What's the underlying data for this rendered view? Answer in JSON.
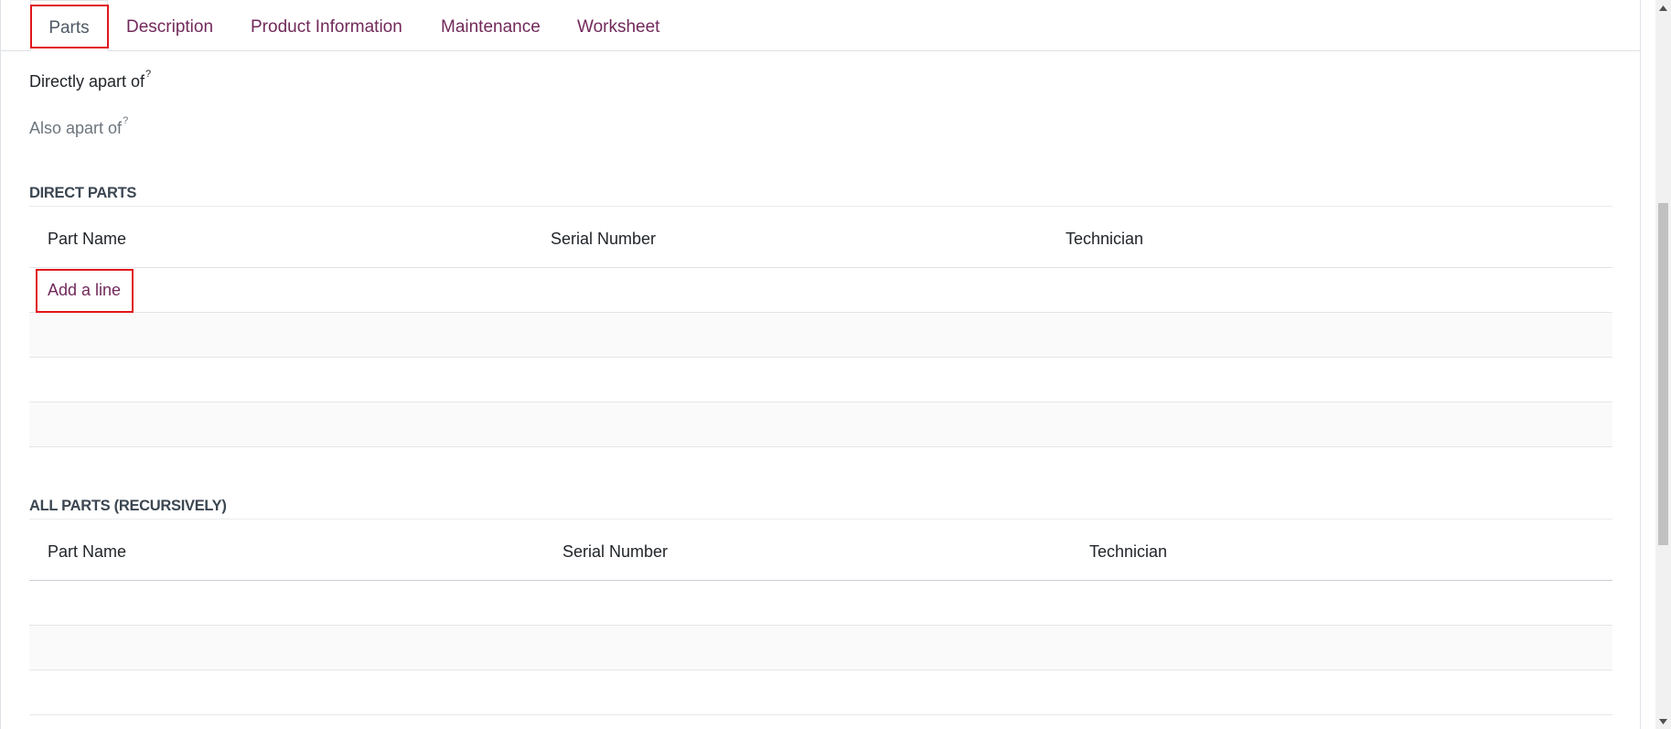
{
  "tabs": [
    {
      "label": "Parts",
      "active": true
    },
    {
      "label": "Description",
      "active": false
    },
    {
      "label": "Product Information",
      "active": false
    },
    {
      "label": "Maintenance",
      "active": false
    },
    {
      "label": "Worksheet",
      "active": false
    }
  ],
  "fields": {
    "directly_apart_of": {
      "label": "Directly apart of",
      "help": "?"
    },
    "also_apart_of": {
      "label": "Also apart of",
      "help": "?"
    }
  },
  "direct_parts": {
    "title": "DIRECT PARTS",
    "columns": [
      "Part Name",
      "Serial Number",
      "Technician"
    ],
    "add_line_label": "Add a line"
  },
  "all_parts": {
    "title": "ALL PARTS (RECURSIVELY)",
    "columns": [
      "Part Name",
      "Serial Number",
      "Technician"
    ]
  },
  "colors": {
    "link": "#71295a",
    "highlight": "#e0161c"
  },
  "icons": {
    "scroll_up": "caret-up-icon",
    "scroll_down": "caret-down-icon"
  }
}
